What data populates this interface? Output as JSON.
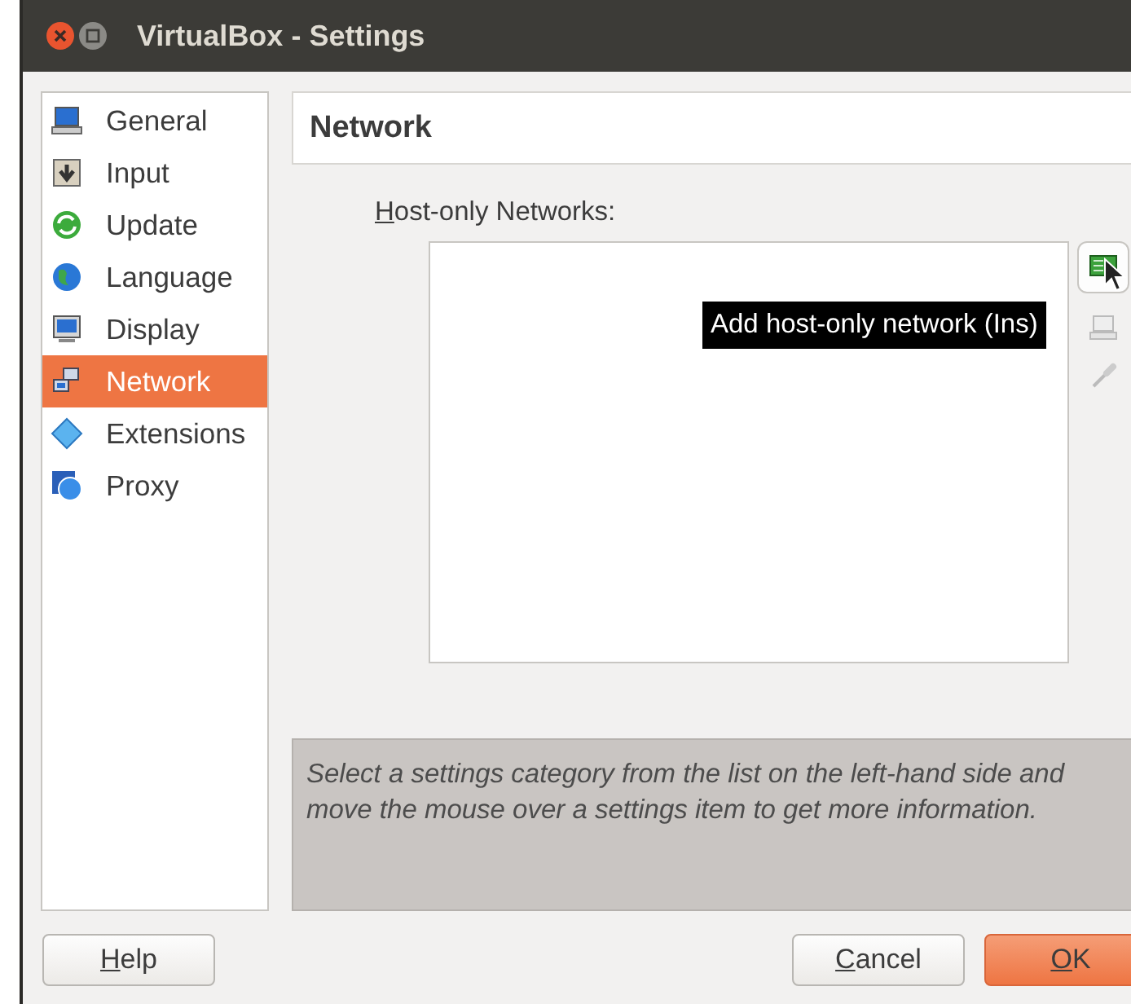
{
  "window": {
    "title": "VirtualBox - Settings"
  },
  "sidebar": {
    "items": [
      {
        "label": "General",
        "selected": false
      },
      {
        "label": "Input",
        "selected": false
      },
      {
        "label": "Update",
        "selected": false
      },
      {
        "label": "Language",
        "selected": false
      },
      {
        "label": "Display",
        "selected": false
      },
      {
        "label": "Network",
        "selected": true
      },
      {
        "label": "Extensions",
        "selected": false
      },
      {
        "label": "Proxy",
        "selected": false
      }
    ]
  },
  "page_title": "Network",
  "networks_label": {
    "key": "H",
    "rest": "ost-only Networks:"
  },
  "tooltip": "Add host-only network (Ins)",
  "info": "Select a settings category from the list on the left-hand side and move the mouse over a settings item to get more information.",
  "buttons": [
    {
      "key": "H",
      "rest": "elp",
      "kind": "help",
      "default": false
    },
    {
      "key": "C",
      "rest": "ancel",
      "kind": "cancel",
      "default": false
    },
    {
      "key": "O",
      "rest": "K",
      "kind": "ok",
      "default": true
    }
  ]
}
